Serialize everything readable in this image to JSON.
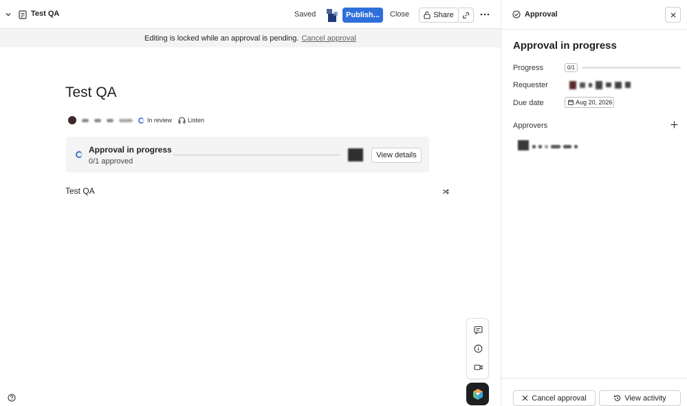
{
  "topbar": {
    "doc_title": "Test QA",
    "saved_label": "Saved",
    "publish_label": "Publish...",
    "close_label": "Close",
    "share_label": "Share"
  },
  "lock_banner": {
    "message": "Editing is locked while an approval is pending.",
    "cancel_link": "Cancel approval"
  },
  "document": {
    "title": "Test QA",
    "status": "In review",
    "listen_label": "Listen",
    "body_text": "Test QA"
  },
  "approval_card": {
    "title": "Approval in progress",
    "subtitle": "0/1 approved",
    "progress": 0,
    "view_details_label": "View details"
  },
  "approval_pane": {
    "header_title": "Approval",
    "title": "Approval in progress",
    "progress_label": "Progress",
    "progress_value": "0/1",
    "progress": 0,
    "requester_label": "Requester",
    "due_date_label": "Due date",
    "due_date_value": "Aug 20, 2026",
    "approvers_label": "Approvers",
    "cancel_approval_label": "Cancel approval",
    "view_activity_label": "View activity"
  },
  "icons": {
    "collapse": "chevron-down-icon",
    "document": "document-icon",
    "lock": "lock-icon",
    "link": "link-icon",
    "more": "more-horizontal-icon",
    "headphones": "headphones-icon",
    "shuffle": "shuffle-icon",
    "comment": "comment-icon",
    "info": "info-icon",
    "video": "video-icon",
    "ai": "ai-assistant-icon",
    "help": "help-icon",
    "check_circle": "check-circle-icon",
    "close": "close-icon",
    "calendar": "calendar-icon",
    "plus": "plus-icon",
    "x": "x-icon",
    "history": "history-icon"
  },
  "colors": {
    "primary": "#2f6fdc",
    "banner_bg": "#f4f4f4",
    "text": "#1e1f21"
  }
}
